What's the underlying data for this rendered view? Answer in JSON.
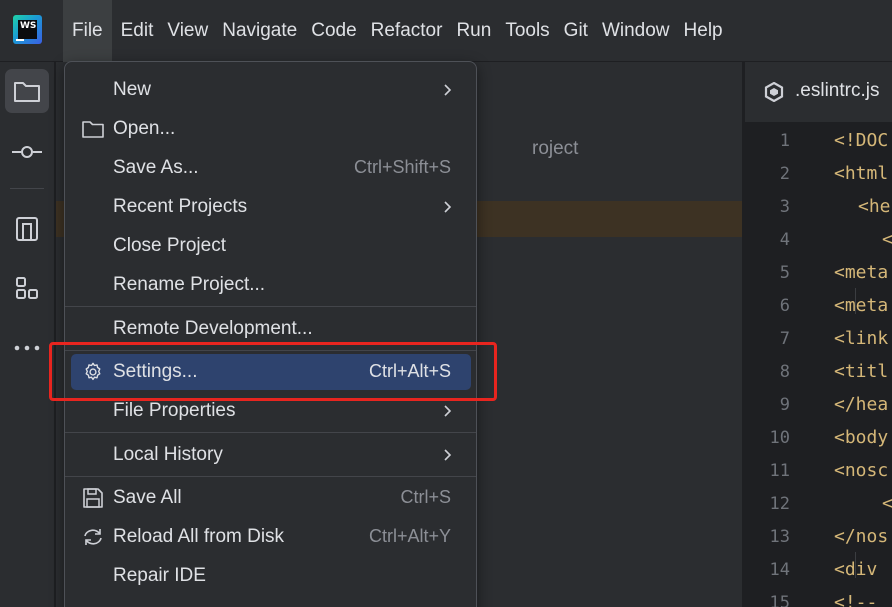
{
  "menubar": {
    "items": [
      "File",
      "Edit",
      "View",
      "Navigate",
      "Code",
      "Refactor",
      "Run",
      "Tools",
      "Git",
      "Window",
      "Help"
    ],
    "active": "File"
  },
  "logo": {
    "text": "WS"
  },
  "project_panel": {
    "visible_text": "roject"
  },
  "editor": {
    "tab_label": ".eslintrc.js",
    "line_numbers": [
      "1",
      "2",
      "3",
      "4",
      "5",
      "6",
      "7",
      "8",
      "9",
      "10",
      "11",
      "12",
      "13",
      "14",
      "15"
    ],
    "code_lines": [
      "<!DOC",
      "<html",
      "<he",
      "<",
      "<meta",
      "<meta",
      "<link",
      "<titl",
      "</hea",
      "<body",
      "<nosc",
      "<",
      "</nos",
      "<div ",
      "<!--"
    ]
  },
  "file_menu": {
    "items": {
      "new": {
        "label": "New",
        "submenu": true
      },
      "open": {
        "label": "Open...",
        "icon": "folder-icon"
      },
      "save_as": {
        "label": "Save As...",
        "shortcut": "Ctrl+Shift+S"
      },
      "recent_projects": {
        "label": "Recent Projects",
        "submenu": true
      },
      "close_project": {
        "label": "Close Project"
      },
      "rename_project": {
        "label": "Rename Project..."
      },
      "remote_development": {
        "label": "Remote Development..."
      },
      "settings": {
        "label": "Settings...",
        "shortcut": "Ctrl+Alt+S",
        "icon": "gear-icon",
        "highlighted": true
      },
      "file_properties": {
        "label": "File Properties",
        "submenu": true
      },
      "local_history": {
        "label": "Local History",
        "submenu": true
      },
      "save_all": {
        "label": "Save All",
        "shortcut": "Ctrl+S",
        "icon": "save-icon"
      },
      "reload_all": {
        "label": "Reload All from Disk",
        "shortcut": "Ctrl+Alt+Y",
        "icon": "reload-icon"
      },
      "repair_ide": {
        "label": "Repair IDE"
      }
    }
  },
  "colors": {
    "highlight": "#2e436e",
    "annotation": "#e8251f",
    "code": "#d5b778"
  }
}
